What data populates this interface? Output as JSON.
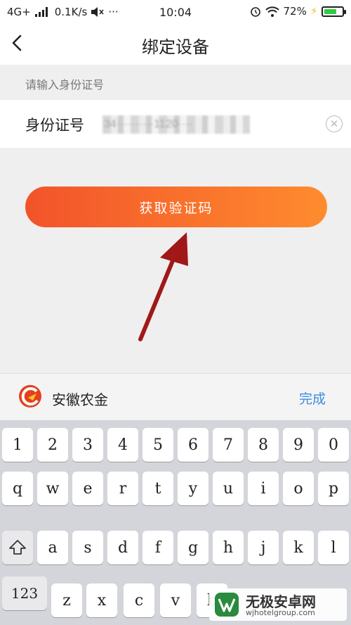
{
  "status_bar": {
    "network": "4G+",
    "speed": "0.1K/s",
    "time": "10:04",
    "battery": "72%",
    "battery_level": 0.72,
    "icons": [
      "signal-icon",
      "mute-icon",
      "more-icon",
      "alarm-icon",
      "wifi-icon",
      "charging-icon",
      "battery-icon"
    ]
  },
  "header": {
    "title": "绑定设备",
    "back_icon": "chevron-left-icon"
  },
  "form": {
    "hint": "请输入身份证号",
    "id_label": "身份证号",
    "id_value": "34··········1120····",
    "clear_icon": "clear-icon"
  },
  "primary_button": {
    "label": "获取验证码",
    "gradient": [
      "#f2532a",
      "#ff8c2e"
    ]
  },
  "annotation": {
    "icon": "red-arrow-icon",
    "color": "#a01818"
  },
  "keyboard_bar": {
    "brand": "安徽农金",
    "done": "完成",
    "done_color": "#3a8ddf"
  },
  "keyboard": {
    "row1": [
      "1",
      "2",
      "3",
      "4",
      "5",
      "6",
      "7",
      "8",
      "9",
      "0"
    ],
    "row2": [
      "q",
      "w",
      "e",
      "r",
      "t",
      "y",
      "u",
      "i",
      "o",
      "p"
    ],
    "row3": [
      "a",
      "s",
      "d",
      "f",
      "g",
      "h",
      "j",
      "k",
      "l"
    ],
    "shift_icon": "shift-icon",
    "row4": [
      "123",
      "z",
      "x",
      "c",
      "v",
      "b"
    ]
  },
  "watermark": {
    "title": "无极安卓网",
    "url": "wjhotelgroup.com"
  }
}
